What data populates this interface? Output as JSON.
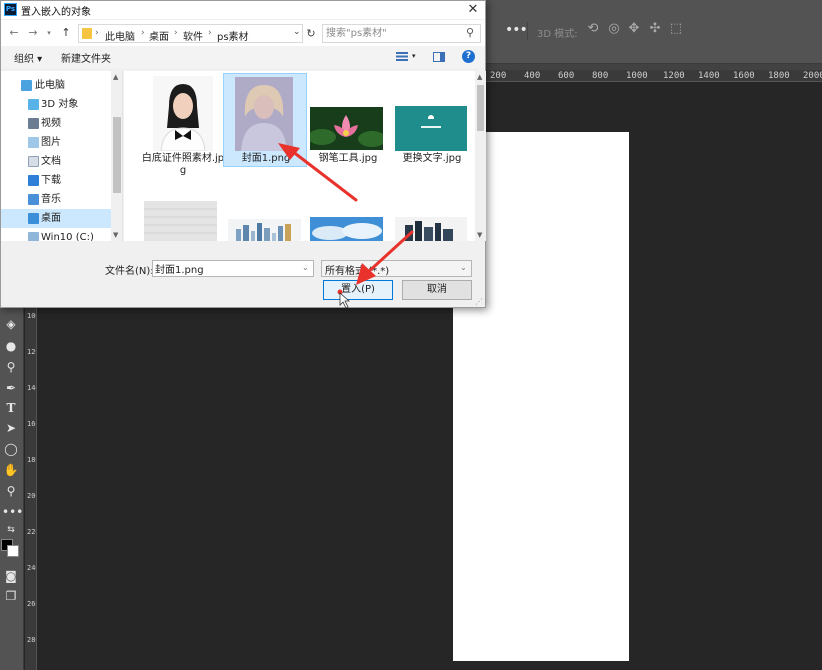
{
  "dialog": {
    "title": "置入嵌入的对象",
    "close": "✕",
    "nav": {
      "back": "←",
      "forward": "→",
      "up": "↑",
      "refresh": "↻"
    },
    "breadcrumb": [
      "此电脑",
      "桌面",
      "软件",
      "ps素材"
    ],
    "search_placeholder": "搜索\"ps素材\"",
    "toolbar": {
      "organize": "组织 ▾",
      "new_folder": "新建文件夹",
      "help": "?"
    },
    "sidebar": [
      {
        "label": "此电脑",
        "icon": "computer-icon",
        "selected": false
      },
      {
        "label": "3D 对象",
        "icon": "3d-objects-icon",
        "selected": false
      },
      {
        "label": "视频",
        "icon": "videos-folder-icon",
        "selected": false
      },
      {
        "label": "图片",
        "icon": "pictures-folder-icon",
        "selected": false
      },
      {
        "label": "文档",
        "icon": "documents-folder-icon",
        "selected": false
      },
      {
        "label": "下载",
        "icon": "downloads-folder-icon",
        "selected": false
      },
      {
        "label": "音乐",
        "icon": "music-folder-icon",
        "selected": false
      },
      {
        "label": "桌面",
        "icon": "desktop-folder-icon",
        "selected": true
      },
      {
        "label": "Win10 (C:)",
        "icon": "drive-icon",
        "selected": false
      }
    ],
    "files": [
      {
        "name": "白底证件照素材.jpg",
        "thumb": "portrait-woman",
        "selected": false
      },
      {
        "name": "封面1.png",
        "thumb": "blonde-woman",
        "selected": true
      },
      {
        "name": "钢笔工具.jpg",
        "thumb": "pink-lotus",
        "selected": false
      },
      {
        "name": "更换文字.jpg",
        "thumb": "teal-banner",
        "selected": false
      },
      {
        "name": "",
        "thumb": "white-texture",
        "selected": false
      },
      {
        "name": "",
        "thumb": "city-skyline",
        "selected": false
      },
      {
        "name": "",
        "thumb": "blue-sky",
        "selected": false
      },
      {
        "name": "",
        "thumb": "dark-buildings",
        "selected": false
      }
    ],
    "filename_label": "文件名(N):",
    "filename_value": "封面1.png",
    "filetype_value": "所有格式 (*.*)",
    "place_button": "置入(P)",
    "cancel_button": "取消"
  },
  "photoshop": {
    "options_more": "•••",
    "mode_3d_label": "3D 模式:",
    "ruler_marks": [
      "200",
      "400",
      "600",
      "800",
      "1000",
      "1200",
      "1400",
      "1600",
      "1800",
      "2000"
    ],
    "vruler_marks": [
      "1000",
      "1200",
      "1400",
      "1600",
      "1800",
      "2000",
      "2200",
      "2400",
      "2600",
      "2800"
    ],
    "tools": [
      "paint-bucket-icon",
      "blur-drop-icon",
      "dodge-icon",
      "pen-icon",
      "type-icon",
      "path-select-icon",
      "ellipse-icon",
      "hand-icon",
      "zoom-icon",
      "more-tools-icon"
    ]
  },
  "colors": {
    "ps_background": "#262626",
    "ps_panel": "#535353",
    "canvas": "#ffffff",
    "selection": "#cce8ff",
    "accent_blue": "#0078d7",
    "arrow_red": "#e8322b"
  }
}
